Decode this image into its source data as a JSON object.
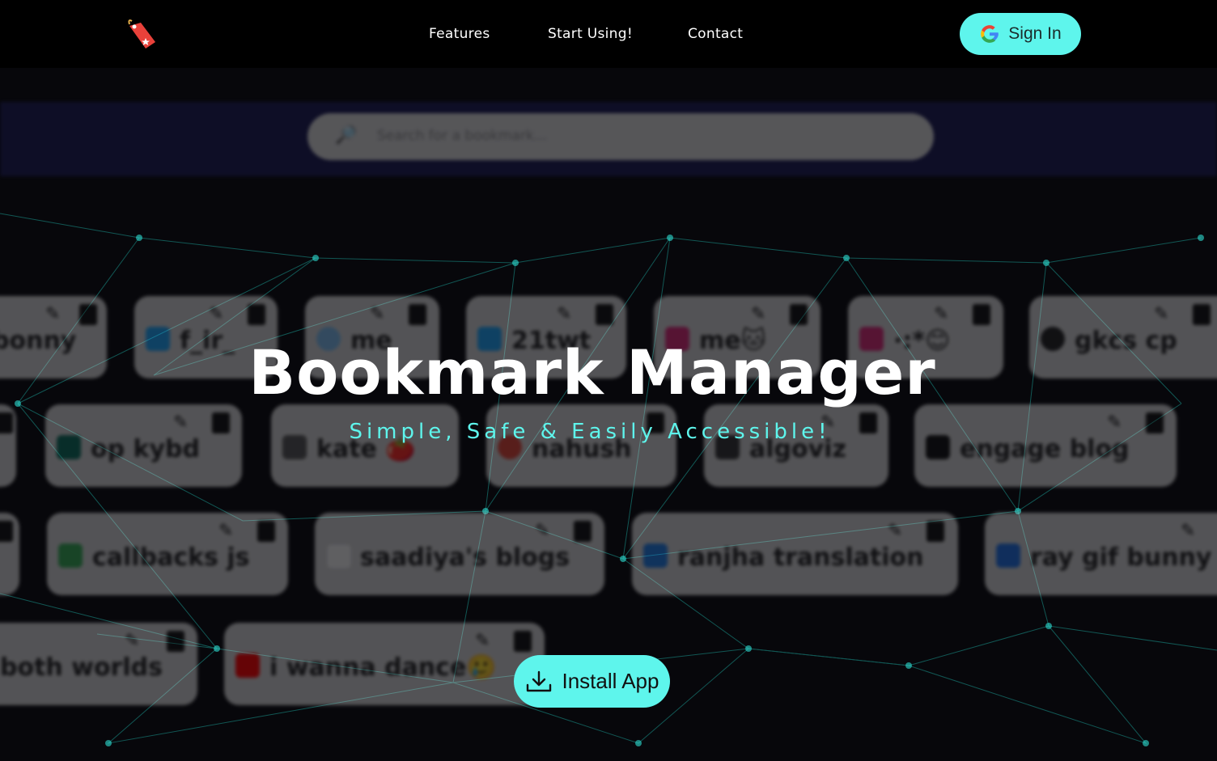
{
  "nav": {
    "logo_icon": "bookmark-tag-icon",
    "items": [
      {
        "label": "Features"
      },
      {
        "label": "Start Using!"
      },
      {
        "label": "Contact"
      }
    ],
    "signin": {
      "label": "Sign In",
      "icon": "google-icon"
    }
  },
  "background": {
    "search_placeholder": "Search for a bookmark...",
    "search_icon": "magnifier-icon",
    "cards": [
      {
        "label": "bonny",
        "icon": ""
      },
      {
        "label": "f_ir_",
        "icon": "twitter-icon"
      },
      {
        "label": "me",
        "icon": "chat-icon"
      },
      {
        "label": "21twt",
        "icon": "twitter-icon"
      },
      {
        "label": "me🐱",
        "icon": "instagram-icon"
      },
      {
        "label": "·:*😊",
        "icon": "instagram-icon"
      },
      {
        "label": "gkcs cp",
        "icon": "github-icon"
      },
      {
        "label": "op kybd",
        "icon": "vercel-icon"
      },
      {
        "label": "kate 🍅",
        "icon": "cube-icon"
      },
      {
        "label": "nahush",
        "icon": "chrome-icon"
      },
      {
        "label": "algoviz",
        "icon": "image-icon"
      },
      {
        "label": "engage blog",
        "icon": "blog-icon"
      },
      {
        "label": "callbacks js",
        "icon": "doc-icon"
      },
      {
        "label": "saadiya's blogs",
        "icon": "page-icon"
      },
      {
        "label": "ranjha translation",
        "icon": "translate-icon"
      },
      {
        "label": "ray gif bunny",
        "icon": "gif-icon"
      },
      {
        "label": "both worlds",
        "icon": ""
      },
      {
        "label": "i wanna dance🥲",
        "icon": "youtube-icon"
      }
    ]
  },
  "hero": {
    "title": "Bookmark Manager",
    "subtitle": "Simple, Safe & Easily Accessible!",
    "install": {
      "label": "Install App",
      "icon": "download-icon"
    }
  },
  "colors": {
    "accent": "#5ef5ec",
    "background": "#050508",
    "network": "#2fe0d4"
  }
}
